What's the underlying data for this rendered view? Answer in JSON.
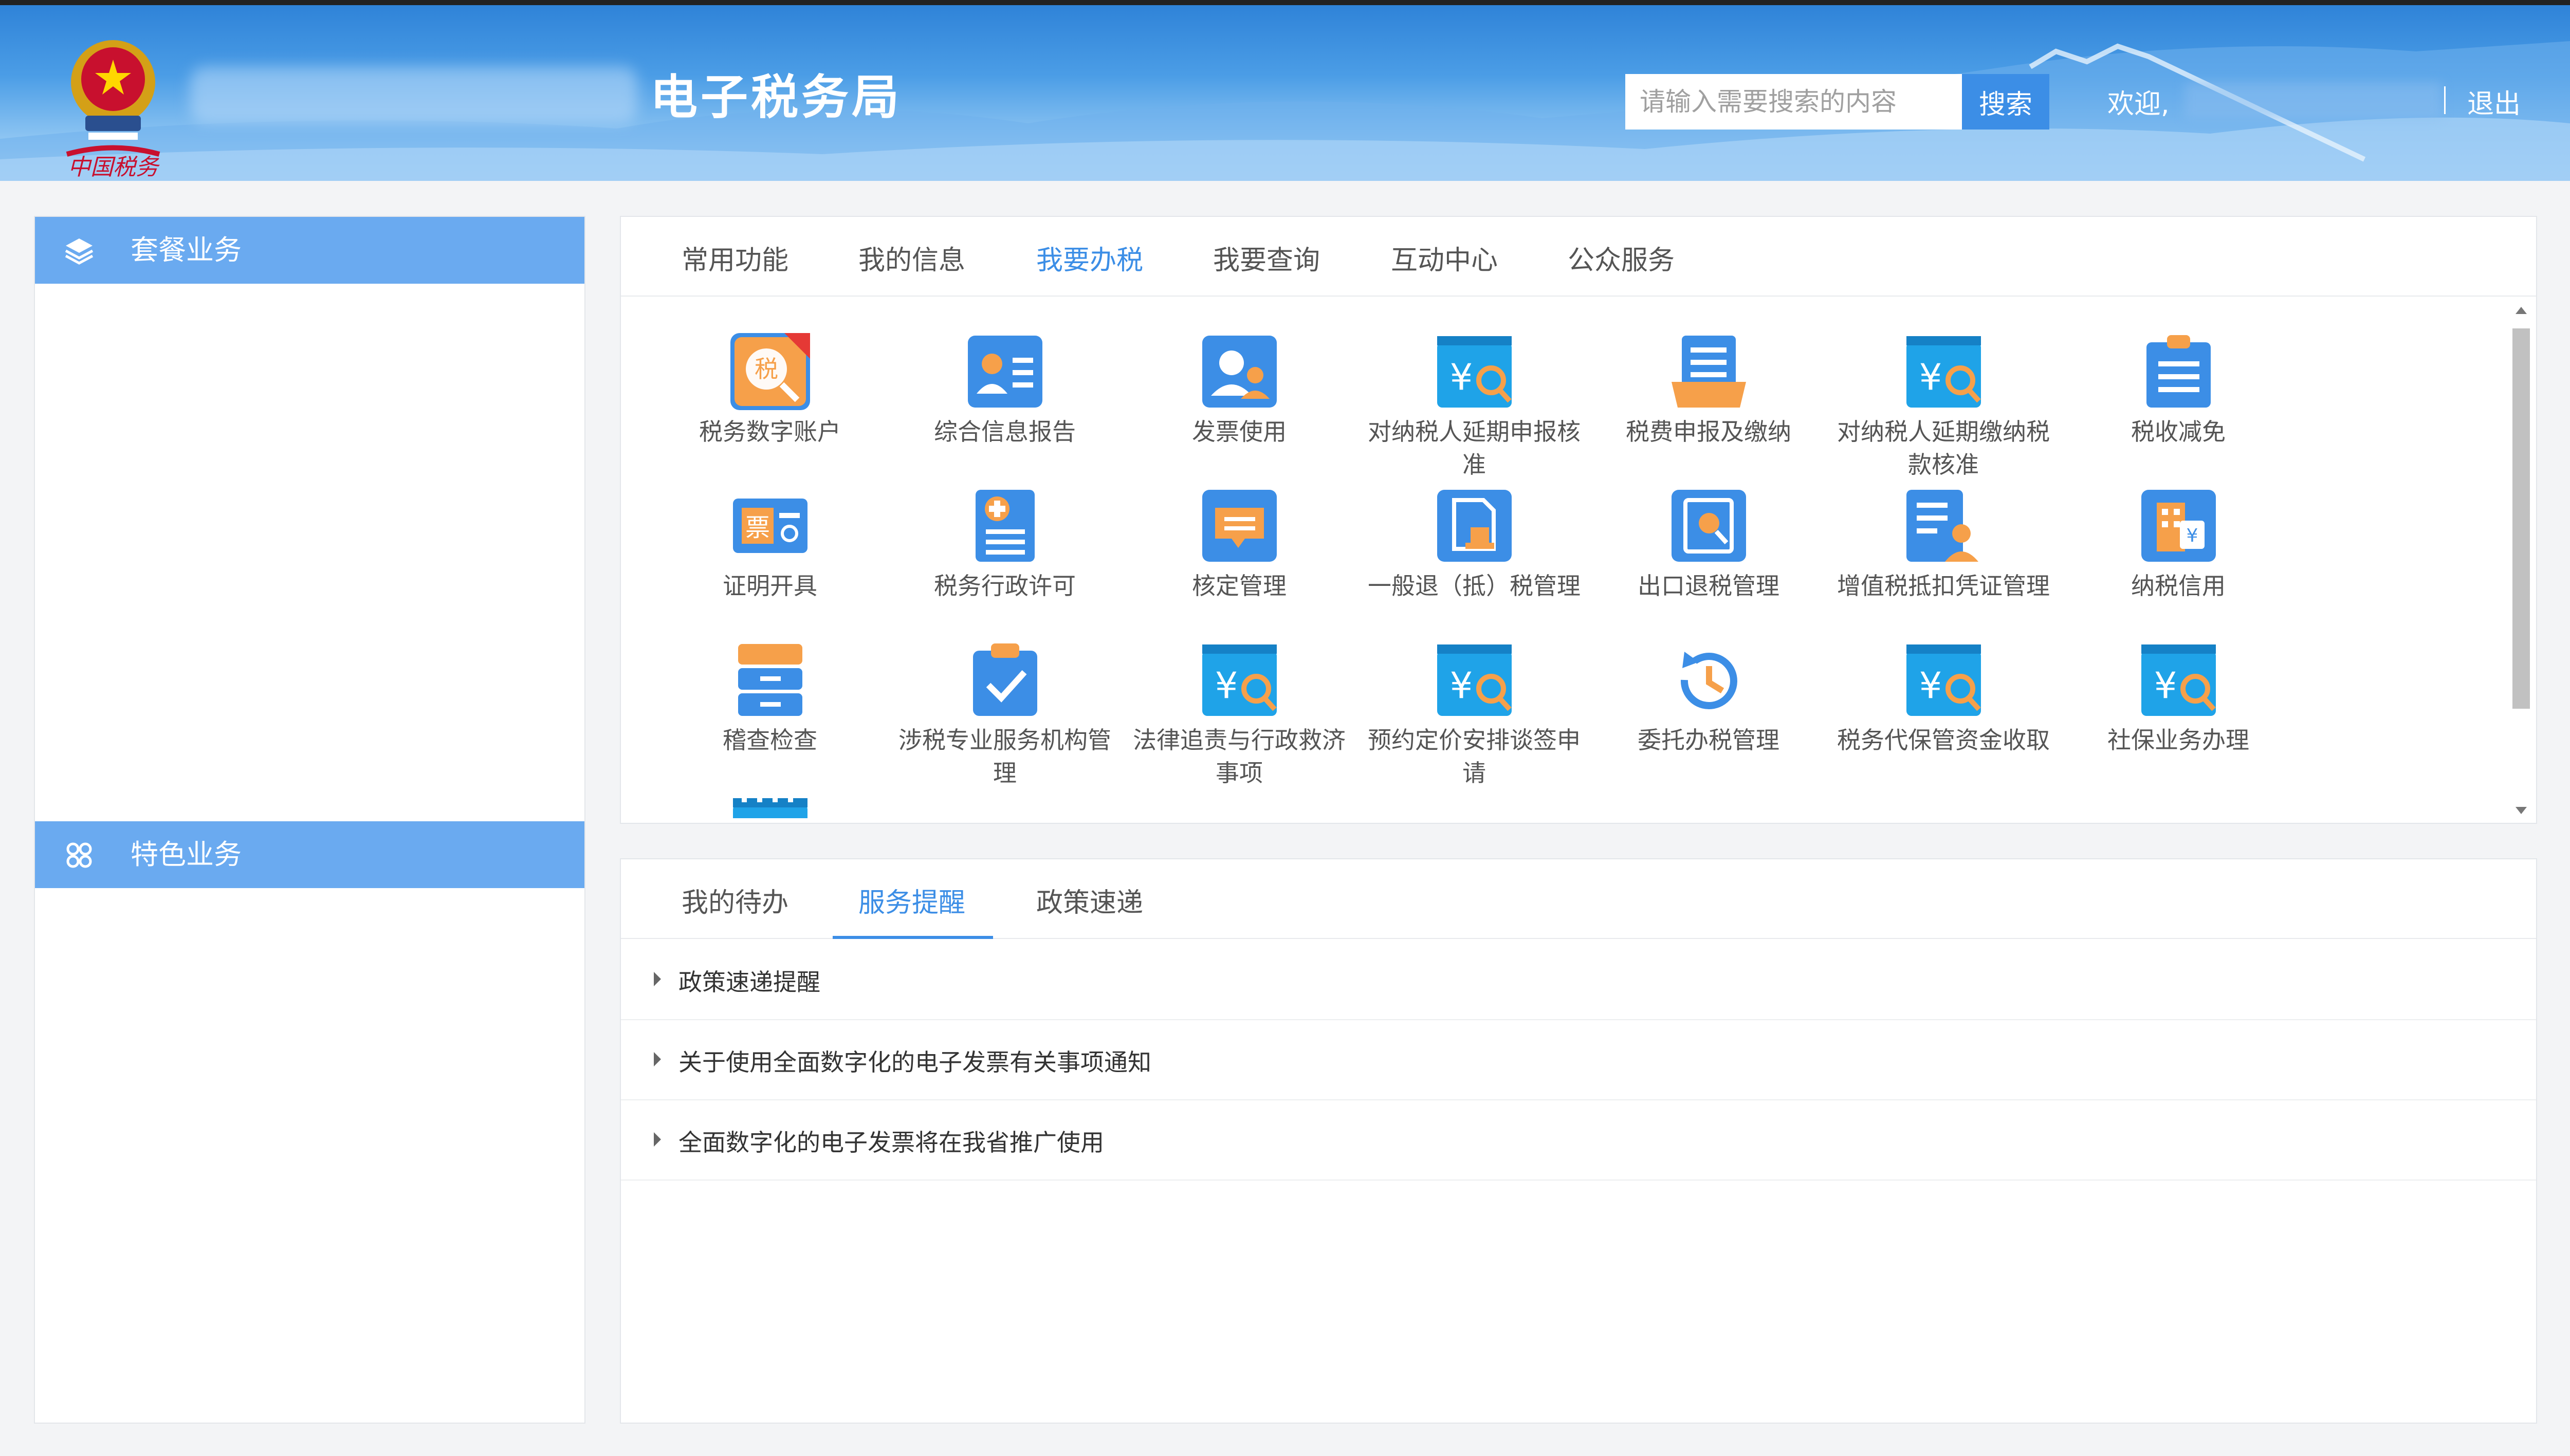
{
  "header": {
    "site_title": "电子税务局",
    "search_placeholder": "请输入需要搜索的内容",
    "search_button": "搜索",
    "welcome": "欢迎,",
    "logout": "退出"
  },
  "sidebar": {
    "sections": [
      {
        "label": "套餐业务",
        "icon": "layers-icon"
      },
      {
        "label": "特色业务",
        "icon": "grid-clover-icon"
      }
    ]
  },
  "main_tabs": [
    "常用功能",
    "我的信息",
    "我要办税",
    "我要查询",
    "互动中心",
    "公众服务"
  ],
  "active_main_tab": "我要办税",
  "functions": [
    {
      "label": "税务数字账户",
      "icon": "tax-account-icon"
    },
    {
      "label": "综合信息报告",
      "icon": "profile-card-icon"
    },
    {
      "label": "发票使用",
      "icon": "users-icon"
    },
    {
      "label": "对纳税人延期申报核准",
      "icon": "yuan-search-icon"
    },
    {
      "label": "税费申报及缴纳",
      "icon": "tray-document-icon"
    },
    {
      "label": "对纳税人延期缴纳税款核准",
      "icon": "yuan-search-icon"
    },
    {
      "label": "税收减免",
      "icon": "clipboard-list-icon"
    },
    {
      "label": "证明开具",
      "icon": "certificate-icon"
    },
    {
      "label": "税务行政许可",
      "icon": "document-plus-icon"
    },
    {
      "label": "核定管理",
      "icon": "message-icon"
    },
    {
      "label": "一般退（抵）税管理",
      "icon": "document-stamp-icon"
    },
    {
      "label": "出口退税管理",
      "icon": "document-search-icon"
    },
    {
      "label": "增值税抵扣凭证管理",
      "icon": "list-person-icon"
    },
    {
      "label": "纳税信用",
      "icon": "building-yuan-icon"
    },
    {
      "label": "稽查检查",
      "icon": "cabinet-icon"
    },
    {
      "label": "涉税专业服务机构管理",
      "icon": "clipboard-check-icon"
    },
    {
      "label": "法律追责与行政救济事项",
      "icon": "yuan-search-icon"
    },
    {
      "label": "预约定价安排谈签申请",
      "icon": "yuan-search-icon"
    },
    {
      "label": "委托办税管理",
      "icon": "clock-history-icon"
    },
    {
      "label": "税务代保管资金收取",
      "icon": "yuan-search-icon"
    },
    {
      "label": "社保业务办理",
      "icon": "yuan-search-icon"
    },
    {
      "label": "",
      "icon": "calendar-icon"
    }
  ],
  "notice_tabs": [
    "我的待办",
    "服务提醒",
    "政策速递"
  ],
  "active_notice_tab": "服务提醒",
  "notices": [
    "政策速递提醒",
    "关于使用全面数字化的电子发票有关事项通知",
    "全面数字化的电子发票将在我省推广使用"
  ],
  "colors": {
    "accent": "#3c8ee6",
    "sidebar_header": "#6aaaf0",
    "header_top": "#2f83d8"
  }
}
